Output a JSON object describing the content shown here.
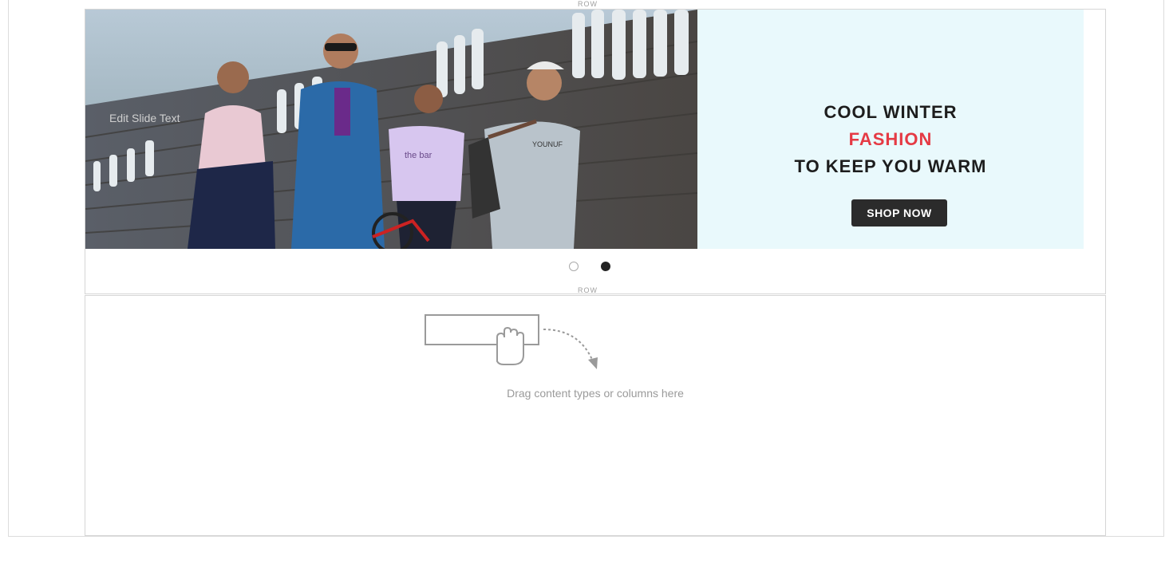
{
  "row_label": "ROW",
  "slider": {
    "edit_text": "Edit Slide Text",
    "headline_line1": "COOL WINTER",
    "headline_line2": "FASHION",
    "headline_line3": "TO KEEP YOU WARM",
    "button_label": "SHOP NOW",
    "tee_text_1": "YOUNUF",
    "tee_text_2": "the bar",
    "colors": {
      "panel_bg": "#e9f9fc",
      "accent": "#e53a44",
      "button_bg": "#2b2b2b"
    },
    "pagination": {
      "total": 2,
      "active": 2
    }
  },
  "empty_row": {
    "hint": "Drag content types or columns here",
    "icon": "hand-drag-icon"
  }
}
